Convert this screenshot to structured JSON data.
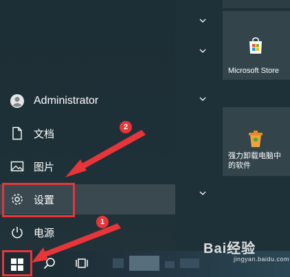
{
  "start_menu": {
    "user": {
      "label": "Administrator",
      "icon": "user-avatar-icon"
    },
    "items": [
      {
        "label": "文档",
        "icon": "document-icon"
      },
      {
        "label": "图片",
        "icon": "picture-icon"
      },
      {
        "label": "设置",
        "icon": "gear-icon",
        "active": true
      },
      {
        "label": "电源",
        "icon": "power-icon"
      }
    ]
  },
  "tiles": [
    {
      "label": "Microsoft Store",
      "icon": "store-icon"
    },
    {
      "label": "强力卸载电脑中的软件",
      "icon": "uninstall-icon"
    }
  ],
  "annotations": {
    "badge_1": "1",
    "badge_2": "2",
    "highlight_color": "#e8353a"
  },
  "watermark": {
    "main": "Bai经验",
    "sub": "jingyan.baidu.com"
  },
  "colors": {
    "accent": "#e8353a",
    "menu_bg": "#1f3138",
    "tile_bg": "#33454b"
  }
}
